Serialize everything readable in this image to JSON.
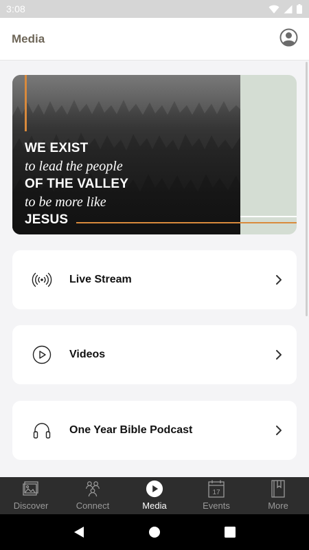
{
  "status": {
    "time": "3:08"
  },
  "header": {
    "title": "Media"
  },
  "banner": {
    "lines": [
      {
        "text": "WE EXIST",
        "style": "bold"
      },
      {
        "text": "to lead the people",
        "style": "italic"
      },
      {
        "text": "OF THE VALLEY",
        "style": "bold"
      },
      {
        "text": "to be more like",
        "style": "italic"
      },
      {
        "text": "JESUS",
        "style": "bold"
      }
    ],
    "accent_color": "#d98a3c",
    "panel_color": "#d4ddd3"
  },
  "cards": [
    {
      "label": "Live Stream",
      "icon": "broadcast-icon"
    },
    {
      "label": "Videos",
      "icon": "play-circle-icon"
    },
    {
      "label": "One Year Bible Podcast",
      "icon": "headphones-icon"
    }
  ],
  "tabs": [
    {
      "label": "Discover",
      "icon": "discover-icon",
      "active": false
    },
    {
      "label": "Connect",
      "icon": "connect-icon",
      "active": false
    },
    {
      "label": "Media",
      "icon": "media-play-icon",
      "active": true
    },
    {
      "label": "Events",
      "icon": "calendar-icon",
      "active": false,
      "icon_text": "17"
    },
    {
      "label": "More",
      "icon": "bookmark-book-icon",
      "active": false
    }
  ]
}
